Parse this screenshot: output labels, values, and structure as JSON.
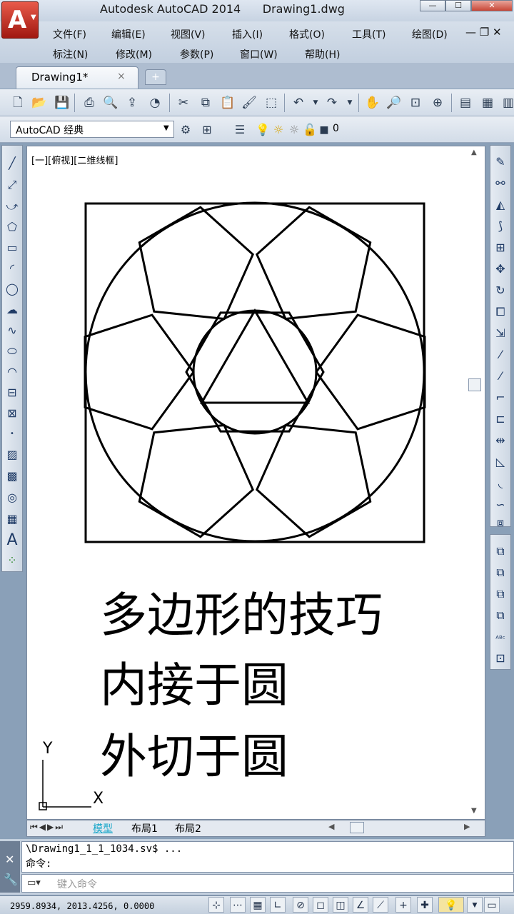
{
  "window": {
    "title": "Autodesk AutoCAD 2014      Drawing1.dwg",
    "app_logo": "A",
    "min_label": "—",
    "max_label": "☐",
    "close_label": "✕"
  },
  "menus": {
    "row1": [
      "文件(F)",
      "编辑(E)",
      "视图(V)",
      "插入(I)",
      "格式(O)",
      "工具(T)",
      "绘图(D)"
    ],
    "row2": [
      "标注(N)",
      "修改(M)",
      "参数(P)",
      "窗口(W)",
      "帮助(H)"
    ],
    "doc_controls": "— ❐ ✕"
  },
  "tabs": {
    "doc_tab": "Drawing1*",
    "close": "×",
    "new": "+"
  },
  "toolbar": {
    "workspace": "AutoCAD 经典",
    "layer": "0",
    "icons": [
      "new-icon",
      "open-icon",
      "save-icon",
      "print-icon",
      "preview-icon",
      "publish-icon",
      "render-icon",
      "cut-icon",
      "copy-icon",
      "paste-icon",
      "match-icon",
      "block-icon",
      "undo-icon",
      "redo-icon",
      "pan-icon",
      "zoom-icon",
      "zoom-window-icon",
      "zoom-prev-icon",
      "properties-icon",
      "design-center-icon",
      "tool-palette-icon"
    ]
  },
  "canvas": {
    "viewport_label": "[一][俯视][二维线框]",
    "text_lines": [
      "多边形的技巧",
      "内接于圆",
      "外切于圆"
    ],
    "ucs_x": "X",
    "ucs_y": "Y",
    "stroke_color": "#000000"
  },
  "layout_tabs": [
    "模型",
    "布局1",
    "布局2"
  ],
  "command": {
    "history1": "\\Drawing1_1_1_1034.sv$ ...",
    "history2": "命令:",
    "placeholder": "键入命令"
  },
  "status": {
    "coords": "2959.8934, 2013.4256, 0.0000"
  },
  "colors": {
    "accent": "#c62b1c",
    "active_layout_tab": "#18a6c9"
  }
}
